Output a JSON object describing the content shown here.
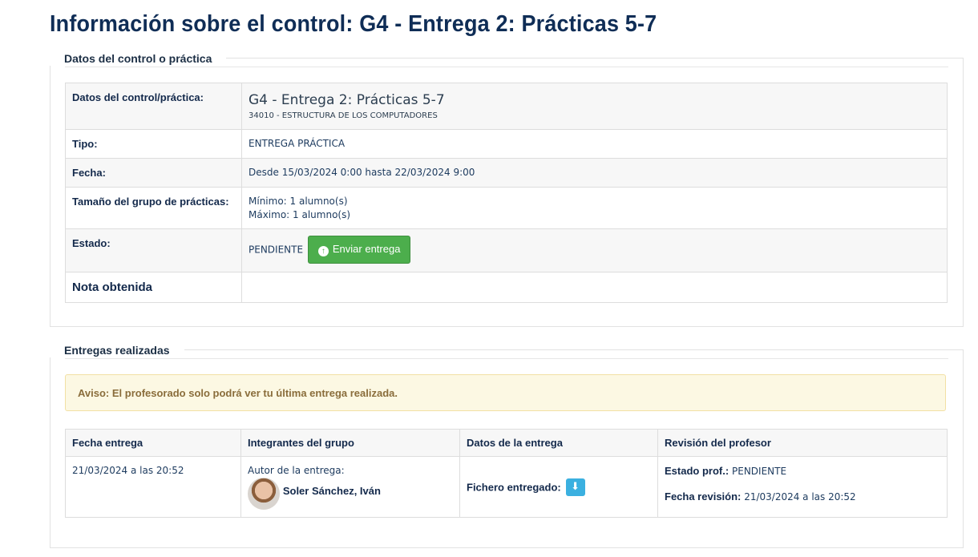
{
  "page": {
    "title": "Información sobre el control: G4 - Entrega 2: Prácticas 5-7"
  },
  "control_section": {
    "legend": "Datos del control o práctica",
    "rows": {
      "datos": {
        "label": "Datos del control/práctica:",
        "title": "G4 - Entrega 2: Prácticas 5-7",
        "subject": "34010 - ESTRUCTURA DE LOS COMPUTADORES"
      },
      "tipo": {
        "label": "Tipo:",
        "value": "ENTREGA PRÁCTICA"
      },
      "fecha": {
        "label": "Fecha:",
        "value": "Desde 15/03/2024 0:00 hasta 22/03/2024 9:00"
      },
      "grupo": {
        "label": "Tamaño del grupo de prácticas:",
        "min": "Mínimo: 1 alumno(s)",
        "max": "Máximo: 1 alumno(s)"
      },
      "estado": {
        "label": "Estado:",
        "value": "PENDIENTE",
        "button_label": "Enviar entrega",
        "button_icon": "arrow-up-circle-icon"
      },
      "nota": {
        "label": "Nota obtenida",
        "value": ""
      }
    }
  },
  "deliveries_section": {
    "legend": "Entregas realizadas",
    "alert": "Aviso: El profesorado solo podrá ver tu última entrega realizada.",
    "columns": [
      "Fecha entrega",
      "Integrantes del grupo",
      "Datos de la entrega",
      "Revisión del profesor"
    ],
    "rows": [
      {
        "fecha": "21/03/2024 a las 20:52",
        "autor_label": "Autor de la entrega:",
        "autor_name": "Soler Sánchez, Iván",
        "fichero_label": "Fichero entregado:",
        "estado_label": "Estado prof.:",
        "estado_value": "PENDIENTE",
        "revision_label": "Fecha revisión:",
        "revision_value": "21/03/2024 a las 20:52"
      }
    ]
  },
  "colors": {
    "title": "#0f2d56",
    "success_button": "#4cae4c",
    "alert_bg": "#fcf8e3",
    "alert_text": "#8a6d3b",
    "download_button": "#3bb0e0"
  }
}
